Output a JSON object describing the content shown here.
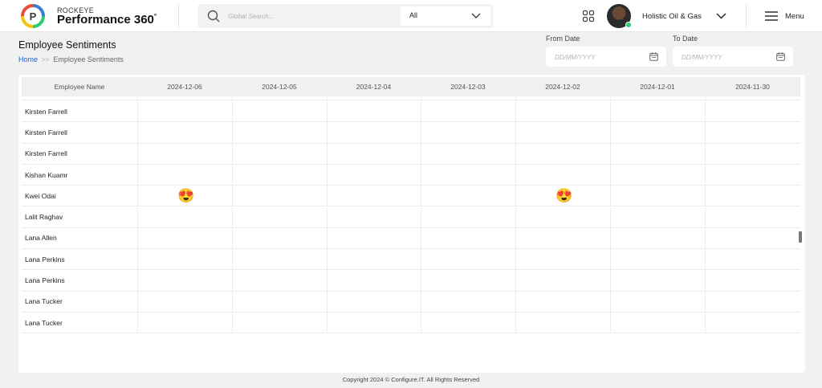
{
  "brand": {
    "top": "ROCKEYE",
    "main": "Performance 360",
    "sup": "°"
  },
  "search": {
    "placeholder": "Global Search...",
    "scope": "All"
  },
  "user": {
    "org": "Holistic Oil & Gas"
  },
  "menu": {
    "label": "Menu"
  },
  "page": {
    "title": "Employee Sentiments",
    "breadcrumb": {
      "home": "Home",
      "sep": ">>",
      "current": "Employee Sentiments"
    }
  },
  "filters": {
    "from": {
      "label": "From Date",
      "placeholder": "DD/MM/YYYY"
    },
    "to": {
      "label": "To Date",
      "placeholder": "DD/MM/YYYY"
    }
  },
  "table": {
    "headers": [
      "Employee Name",
      "2024-12-06",
      "2024-12-05",
      "2024-12-04",
      "2024-12-03",
      "2024-12-02",
      "2024-12-01",
      "2024-11-30"
    ],
    "rows": [
      {
        "name": "Kirsten Farrell",
        "sentiments": [
          "",
          "",
          "",
          "",
          "",
          "",
          ""
        ]
      },
      {
        "name": "Kirsten Farrell",
        "sentiments": [
          "",
          "",
          "",
          "",
          "",
          "",
          ""
        ]
      },
      {
        "name": "Kirsten Farrell",
        "sentiments": [
          "",
          "",
          "",
          "",
          "",
          "",
          ""
        ]
      },
      {
        "name": "Kishan Kuamr",
        "sentiments": [
          "",
          "",
          "",
          "",
          "",
          "",
          ""
        ]
      },
      {
        "name": "Kwei Odai",
        "sentiments": [
          "😍",
          "",
          "",
          "",
          "😍",
          "",
          ""
        ]
      },
      {
        "name": "Lalit Raghav",
        "sentiments": [
          "",
          "",
          "",
          "",
          "",
          "",
          ""
        ]
      },
      {
        "name": "Lana Allen",
        "sentiments": [
          "",
          "",
          "",
          "",
          "",
          "",
          ""
        ]
      },
      {
        "name": "Lana Perkins",
        "sentiments": [
          "",
          "",
          "",
          "",
          "",
          "",
          ""
        ]
      },
      {
        "name": "Lana Perkins",
        "sentiments": [
          "",
          "",
          "",
          "",
          "",
          "",
          ""
        ]
      },
      {
        "name": "Lana Tucker",
        "sentiments": [
          "",
          "",
          "",
          "",
          "",
          "",
          ""
        ]
      },
      {
        "name": "Lana Tucker",
        "sentiments": [
          "",
          "",
          "",
          "",
          "",
          "",
          ""
        ]
      }
    ]
  },
  "footer": {
    "text": "Copyright 2024 © Configure.IT. All Rights Reserved"
  },
  "colors": {
    "accent": "#1a5fd0",
    "online": "#2ecc71"
  }
}
